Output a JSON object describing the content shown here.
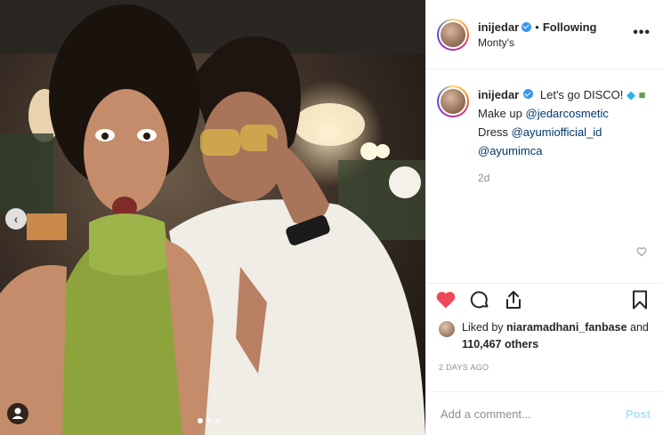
{
  "post": {
    "username": "inijedar",
    "follow_status": "Following",
    "separator": "•",
    "location": "Monty's",
    "more_label": "•••"
  },
  "caption": {
    "username": "inijedar",
    "text": "Let's go DISCO!",
    "line2_prefix": "Make up",
    "makeup_tag": "@jedarcosmetic",
    "line3_prefix": "Dress",
    "dress_tag1": "@ayumiofficial_id",
    "dress_tag2": "@ayumimca",
    "time": "2d"
  },
  "likes": {
    "prefix": "Liked by",
    "user": "niaramadhani_fanbase",
    "middle": "and",
    "count": "110,467 others"
  },
  "posted_ago": "2 DAYS AGO",
  "comment": {
    "placeholder": "Add a comment...",
    "post_label": "Post"
  },
  "carousel": {
    "prev_glyph": "‹",
    "dots": 3,
    "active_dot": 1
  },
  "colors": {
    "verified": "#3897f0",
    "like_red": "#ed4956",
    "link": "#00376b",
    "post_disabled": "#b2dffc"
  }
}
